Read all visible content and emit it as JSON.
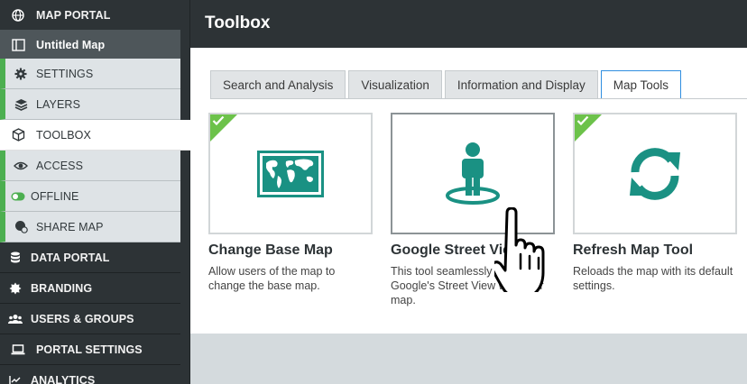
{
  "sidebar": {
    "items": [
      {
        "label": "MAP PORTAL",
        "icon": "globe-icon"
      },
      {
        "label": "Untitled Map",
        "icon": "map-icon"
      },
      {
        "label": "SETTINGS",
        "icon": "gear-icon"
      },
      {
        "label": "LAYERS",
        "icon": "layers-icon"
      },
      {
        "label": "TOOLBOX",
        "icon": "cube-icon"
      },
      {
        "label": "ACCESS",
        "icon": "eye-icon"
      },
      {
        "label": "OFFLINE",
        "icon": "toggle-icon"
      },
      {
        "label": "SHARE MAP",
        "icon": "share-globe-icon"
      },
      {
        "label": "DATA PORTAL",
        "icon": "database-icon"
      },
      {
        "label": "BRANDING",
        "icon": "badge-icon"
      },
      {
        "label": "USERS & GROUPS",
        "icon": "users-icon"
      },
      {
        "label": "PORTAL SETTINGS",
        "icon": "laptop-icon"
      },
      {
        "label": "ANALYTICS",
        "icon": "chart-icon"
      }
    ]
  },
  "header": {
    "title": "Toolbox"
  },
  "tabs": [
    {
      "label": "Search and Analysis"
    },
    {
      "label": "Visualization"
    },
    {
      "label": "Information and Display"
    },
    {
      "label": "Map Tools"
    }
  ],
  "cards": [
    {
      "title": "Change Base Map",
      "desc": "Allow users of the map to change the base map.",
      "icon": "world-map-icon",
      "enabled": true
    },
    {
      "title": "Google Street View",
      "desc": "This tool seamlessly integrates Google's Street View with your map.",
      "icon": "street-view-person-icon",
      "enabled": false
    },
    {
      "title": "Refresh Map Tool",
      "desc": "Reloads the map with its default settings.",
      "icon": "refresh-icon",
      "enabled": true
    }
  ],
  "colors": {
    "accent": "#1a9183",
    "check": "#6cc24a",
    "sidebar": "#2d3336",
    "tabActiveBorder": "#2f8ee0"
  }
}
